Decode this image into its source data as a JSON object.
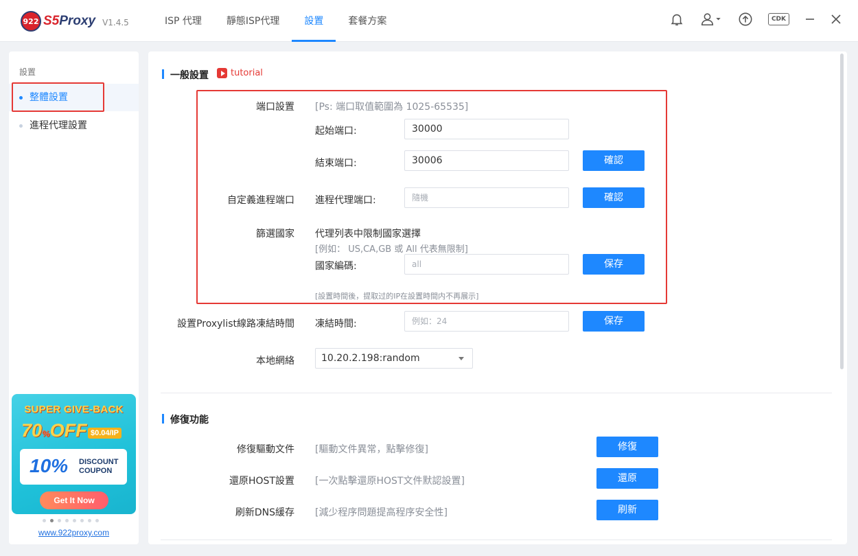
{
  "app": {
    "brand_badge": "922",
    "brand_s5": "S5",
    "brand_name": "Proxy",
    "version": "V1.4.5"
  },
  "nav": {
    "tabs": [
      {
        "label": "ISP 代理"
      },
      {
        "label": "靜態ISP代理"
      },
      {
        "label": "設置"
      },
      {
        "label": "套餐方案"
      }
    ],
    "active": "設置"
  },
  "topbar": {
    "cdk_label": "CDK"
  },
  "sidebar": {
    "group_title": "設置",
    "items": [
      {
        "label": "整體設置"
      },
      {
        "label": "進程代理設置"
      }
    ],
    "promo": {
      "title": "SUPER GIVE-BACK",
      "off_big": "70",
      "off_pct": "%",
      "off_word": "OFF",
      "price": "$0.04/IP",
      "coupon_pct": "10%",
      "coupon_line1": "DISCOUNT",
      "coupon_line2": "COUPON",
      "button": "Get It Now"
    },
    "carousel": {
      "count": 8,
      "active": 1
    },
    "link": "www.922proxy.com"
  },
  "general": {
    "title": "一般設置",
    "tutorial": "tutorial",
    "port": {
      "label": "端口設置",
      "hint": "[Ps: 端口取值範圍為 1025-65535]",
      "start_label": "起始端口:",
      "start_value": "30000",
      "end_label": "結束端口:",
      "end_value": "30006",
      "confirm": "確認"
    },
    "custom_port": {
      "label": "自定義進程端口",
      "field_label": "進程代理端口:",
      "placeholder": "隨機",
      "confirm": "確認"
    },
    "country": {
      "label": "篩選國家",
      "desc": "代理列表中限制國家選擇",
      "example": "[例如： US,CA,GB 或 All 代表無限制]",
      "field_label": "國家編碼:",
      "placeholder": "all",
      "save": "保存",
      "note": "[設置時間後，提取过的IP在設置時間内不再展示]"
    },
    "freeze": {
      "label": "設置Proxylist線路凍結時間",
      "field_label": "凍結時間:",
      "placeholder": "例如：24",
      "save": "保存"
    },
    "network": {
      "label": "本地網絡",
      "value": "10.20.2.198:random"
    }
  },
  "repair": {
    "title": "修復功能",
    "rows": [
      {
        "label": "修復驅動文件",
        "desc": "[驅動文件異常，點擊修復]",
        "button": "修復"
      },
      {
        "label": "還原HOST設置",
        "desc": "[一次點擊還原HOST文件默認設置]",
        "button": "還原"
      },
      {
        "label": "刷新DNS緩存",
        "desc": "[減少程序問題提高程序安全性]",
        "button": "刷新"
      }
    ]
  },
  "colors": {
    "accent": "#1e88ff",
    "highlight": "#e53935"
  }
}
